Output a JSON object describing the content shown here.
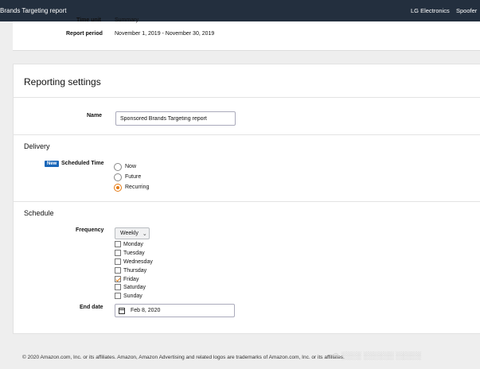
{
  "header": {
    "title": "Brands Targeting report",
    "advertiser": "LG Electronics",
    "user": "Spoofer"
  },
  "report_info": {
    "time_unit_label": "Time unit",
    "time_unit_value": "Summary",
    "period_label": "Report period",
    "period_value": "November 1, 2019 - November 30, 2019"
  },
  "settings": {
    "title": "Reporting settings",
    "name_label": "Name",
    "name_value": "Sponsored Brands Targeting report"
  },
  "delivery": {
    "title": "Delivery",
    "new_badge": "New",
    "scheduled_label": "Scheduled Time",
    "options": [
      {
        "label": "Now",
        "selected": false
      },
      {
        "label": "Future",
        "selected": false
      },
      {
        "label": "Recurring",
        "selected": true
      }
    ]
  },
  "schedule": {
    "title": "Schedule",
    "frequency_label": "Frequency",
    "frequency_value": "Weekly",
    "days": [
      {
        "label": "Monday",
        "checked": false
      },
      {
        "label": "Tuesday",
        "checked": false
      },
      {
        "label": "Wednesday",
        "checked": false
      },
      {
        "label": "Thursday",
        "checked": false
      },
      {
        "label": "Friday",
        "checked": true
      },
      {
        "label": "Saturday",
        "checked": false
      },
      {
        "label": "Sunday",
        "checked": false
      }
    ],
    "end_date_label": "End date",
    "end_date_value": "Feb 8, 2020"
  },
  "footer": {
    "text": "© 2020 Amazon.com, Inc. or its affiliates. Amazon, Amazon Advertising and related logos are trademarks of Amazon.com, Inc. or its affiliates."
  },
  "colors": {
    "topbar": "#232f3e",
    "accent": "#e47911",
    "badge": "#1a66b8"
  }
}
